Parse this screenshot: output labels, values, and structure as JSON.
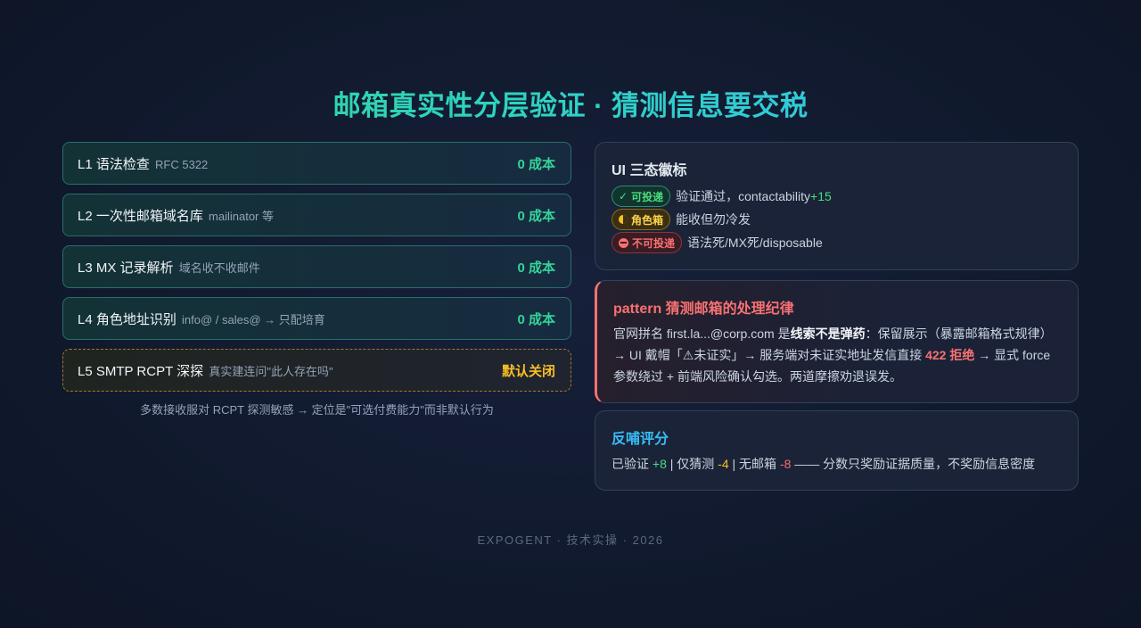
{
  "title": "邮箱真实性分层验证 · 猜测信息要交税",
  "layers": [
    {
      "name": "L1 语法检查",
      "sub": "RFC 5322",
      "cost": "0 成本"
    },
    {
      "name": "L2 一次性邮箱域名库",
      "sub": "mailinator 等",
      "cost": "0 成本"
    },
    {
      "name": "L3 MX 记录解析",
      "sub": "域名收不收邮件",
      "cost": "0 成本"
    },
    {
      "name": "L4 角色地址识别",
      "sub": "info@ / sales@ → 只配培育",
      "cost": "0 成本"
    },
    {
      "name": "L5 SMTP RCPT 深探",
      "sub": "真实建连问\"此人存在吗\"",
      "cost": "默认关闭"
    }
  ],
  "layer_note": "多数接收服对 RCPT 探测敏感 → 定位是\"可选付费能力\"而非默认行为",
  "badges_card": {
    "title": "UI 三态徽标",
    "rows": [
      {
        "badge": "可投递",
        "icon": "check-icon",
        "text": "验证通过，contactability ",
        "delta": "+15"
      },
      {
        "badge": "角色箱",
        "icon": "half-circle-icon",
        "text": "能收但勿冷发"
      },
      {
        "badge": "不可投递",
        "icon": "no-entry-icon",
        "text": "语法死/MX死/disposable"
      }
    ]
  },
  "pattern_card": {
    "title": "pattern 猜测邮箱的处理纪律",
    "p1": "官网拼名 first.la...@corp.com 是",
    "bold1": "线索不是弹药",
    "p2": "：保留展示（暴露邮箱格式规律）→ UI 戴帽「⚠未证实」→ 服务端对未证实地址发信直接 ",
    "reject": "422 拒绝",
    "p3": " → 显式 force 参数绕过 + 前端风险确认勾选。两道摩擦劝退误发。"
  },
  "score_card": {
    "title": "反哺评分",
    "verified_label": "已验证 ",
    "verified": "+8",
    "sep": " | ",
    "guess_label": "仅猜测 ",
    "guess": "-4",
    "none_label": "无邮箱 ",
    "none": "-8",
    "tail": " —— 分数只奖励证据质量，不奖励信息密度"
  },
  "footer": "EXPOGENT · 技术实操 · 2026",
  "colors": {
    "accent_green": "#34d399",
    "accent_blue": "#38bdf8",
    "warn": "#fbbf24",
    "danger": "#f87171"
  }
}
